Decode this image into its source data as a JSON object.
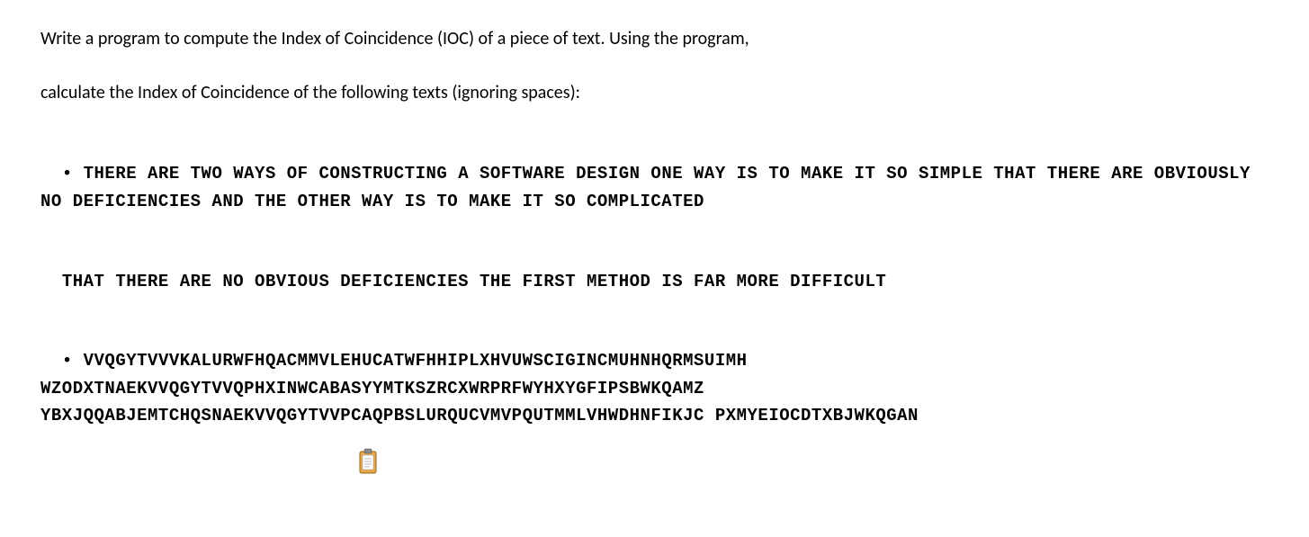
{
  "intro": {
    "line1": "Write a program to compute the Index of Coincidence (IOC) of a piece of text. Using the program,",
    "line2": "calculate the Index of Coincidence of the following texts (ignoring spaces):"
  },
  "texts": {
    "block1_part1": "THERE ARE TWO WAYS OF CONSTRUCTING A SOFTWARE DESIGN ONE WAY IS TO MAKE IT SO SIMPLE THAT THERE ARE OBVIOUSLY NO DEFICIENCIES AND THE OTHER WAY IS TO MAKE IT SO COMPLICATED",
    "block1_part2": "THAT THERE ARE NO OBVIOUS DEFICIENCIES THE FIRST METHOD IS FAR MORE DIFFICULT",
    "block2": "VVQGYTVVVKALURWFHQACMMVLEHUCATWFHHIPLXHVUWSCIGINCMUHNHQRMSUIMH WZODXTNAEKVVQGYTVVQPHXINWCABASYYMTKSZRCXWRPRFWYHXYGFIPSBWKQAMZ YBXJQQABJEMTCHQSNAEKVVQGYTVVPCAQPBSLURQUCVMVPQUTMMLVHWDHNFIKJC PXMYEIOCDTXBJWKQGAN"
  }
}
